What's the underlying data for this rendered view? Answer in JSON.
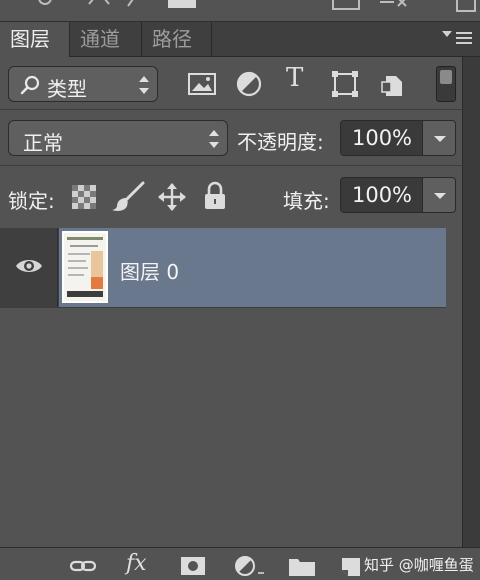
{
  "tabs": [
    {
      "label": "图层",
      "active": true
    },
    {
      "label": "通道",
      "active": false
    },
    {
      "label": "路径",
      "active": false
    }
  ],
  "filter": {
    "kind_label": "类型",
    "icons": [
      "image-filter-icon",
      "adjustment-filter-icon",
      "type-filter-icon",
      "shape-filter-icon",
      "smart-object-filter-icon"
    ],
    "type_glyph": "T"
  },
  "blend": {
    "mode": "正常",
    "opacity_label": "不透明度:",
    "opacity_value": "100%"
  },
  "locks": {
    "label": "锁定:",
    "fill_label": "填充:",
    "fill_value": "100%"
  },
  "layers": [
    {
      "name": "图层 0",
      "visible": true,
      "selected": true
    }
  ],
  "footer": {
    "fx_label": "fx",
    "watermark": "知乎 @咖喱鱼蛋"
  },
  "colors": {
    "panel_bg": "#535353",
    "tab_bar": "#3f3f3f",
    "selected_layer": "#69788d",
    "field_dark": "#3a3a3a"
  }
}
